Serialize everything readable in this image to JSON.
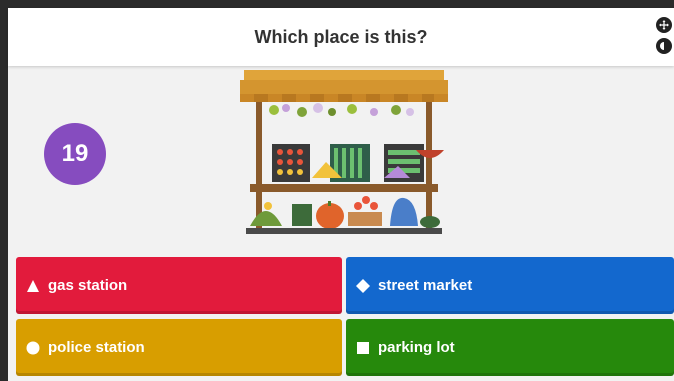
{
  "question": {
    "text": "Which place is this?"
  },
  "timer": {
    "value": "19"
  },
  "image": {
    "icon": "street-market-stall-illustration"
  },
  "controls": {
    "top_icon": "move-icon",
    "bottom_icon": "volume-icon"
  },
  "answers": [
    {
      "label": "gas station",
      "shape": "triangle",
      "color": "#e21b3c"
    },
    {
      "label": "street market",
      "shape": "diamond",
      "color": "#1368ce"
    },
    {
      "label": "police station",
      "shape": "circle",
      "color": "#d89e00"
    },
    {
      "label": "parking lot",
      "shape": "square",
      "color": "#26890c"
    }
  ],
  "colors": {
    "timer": "#864cbf"
  }
}
